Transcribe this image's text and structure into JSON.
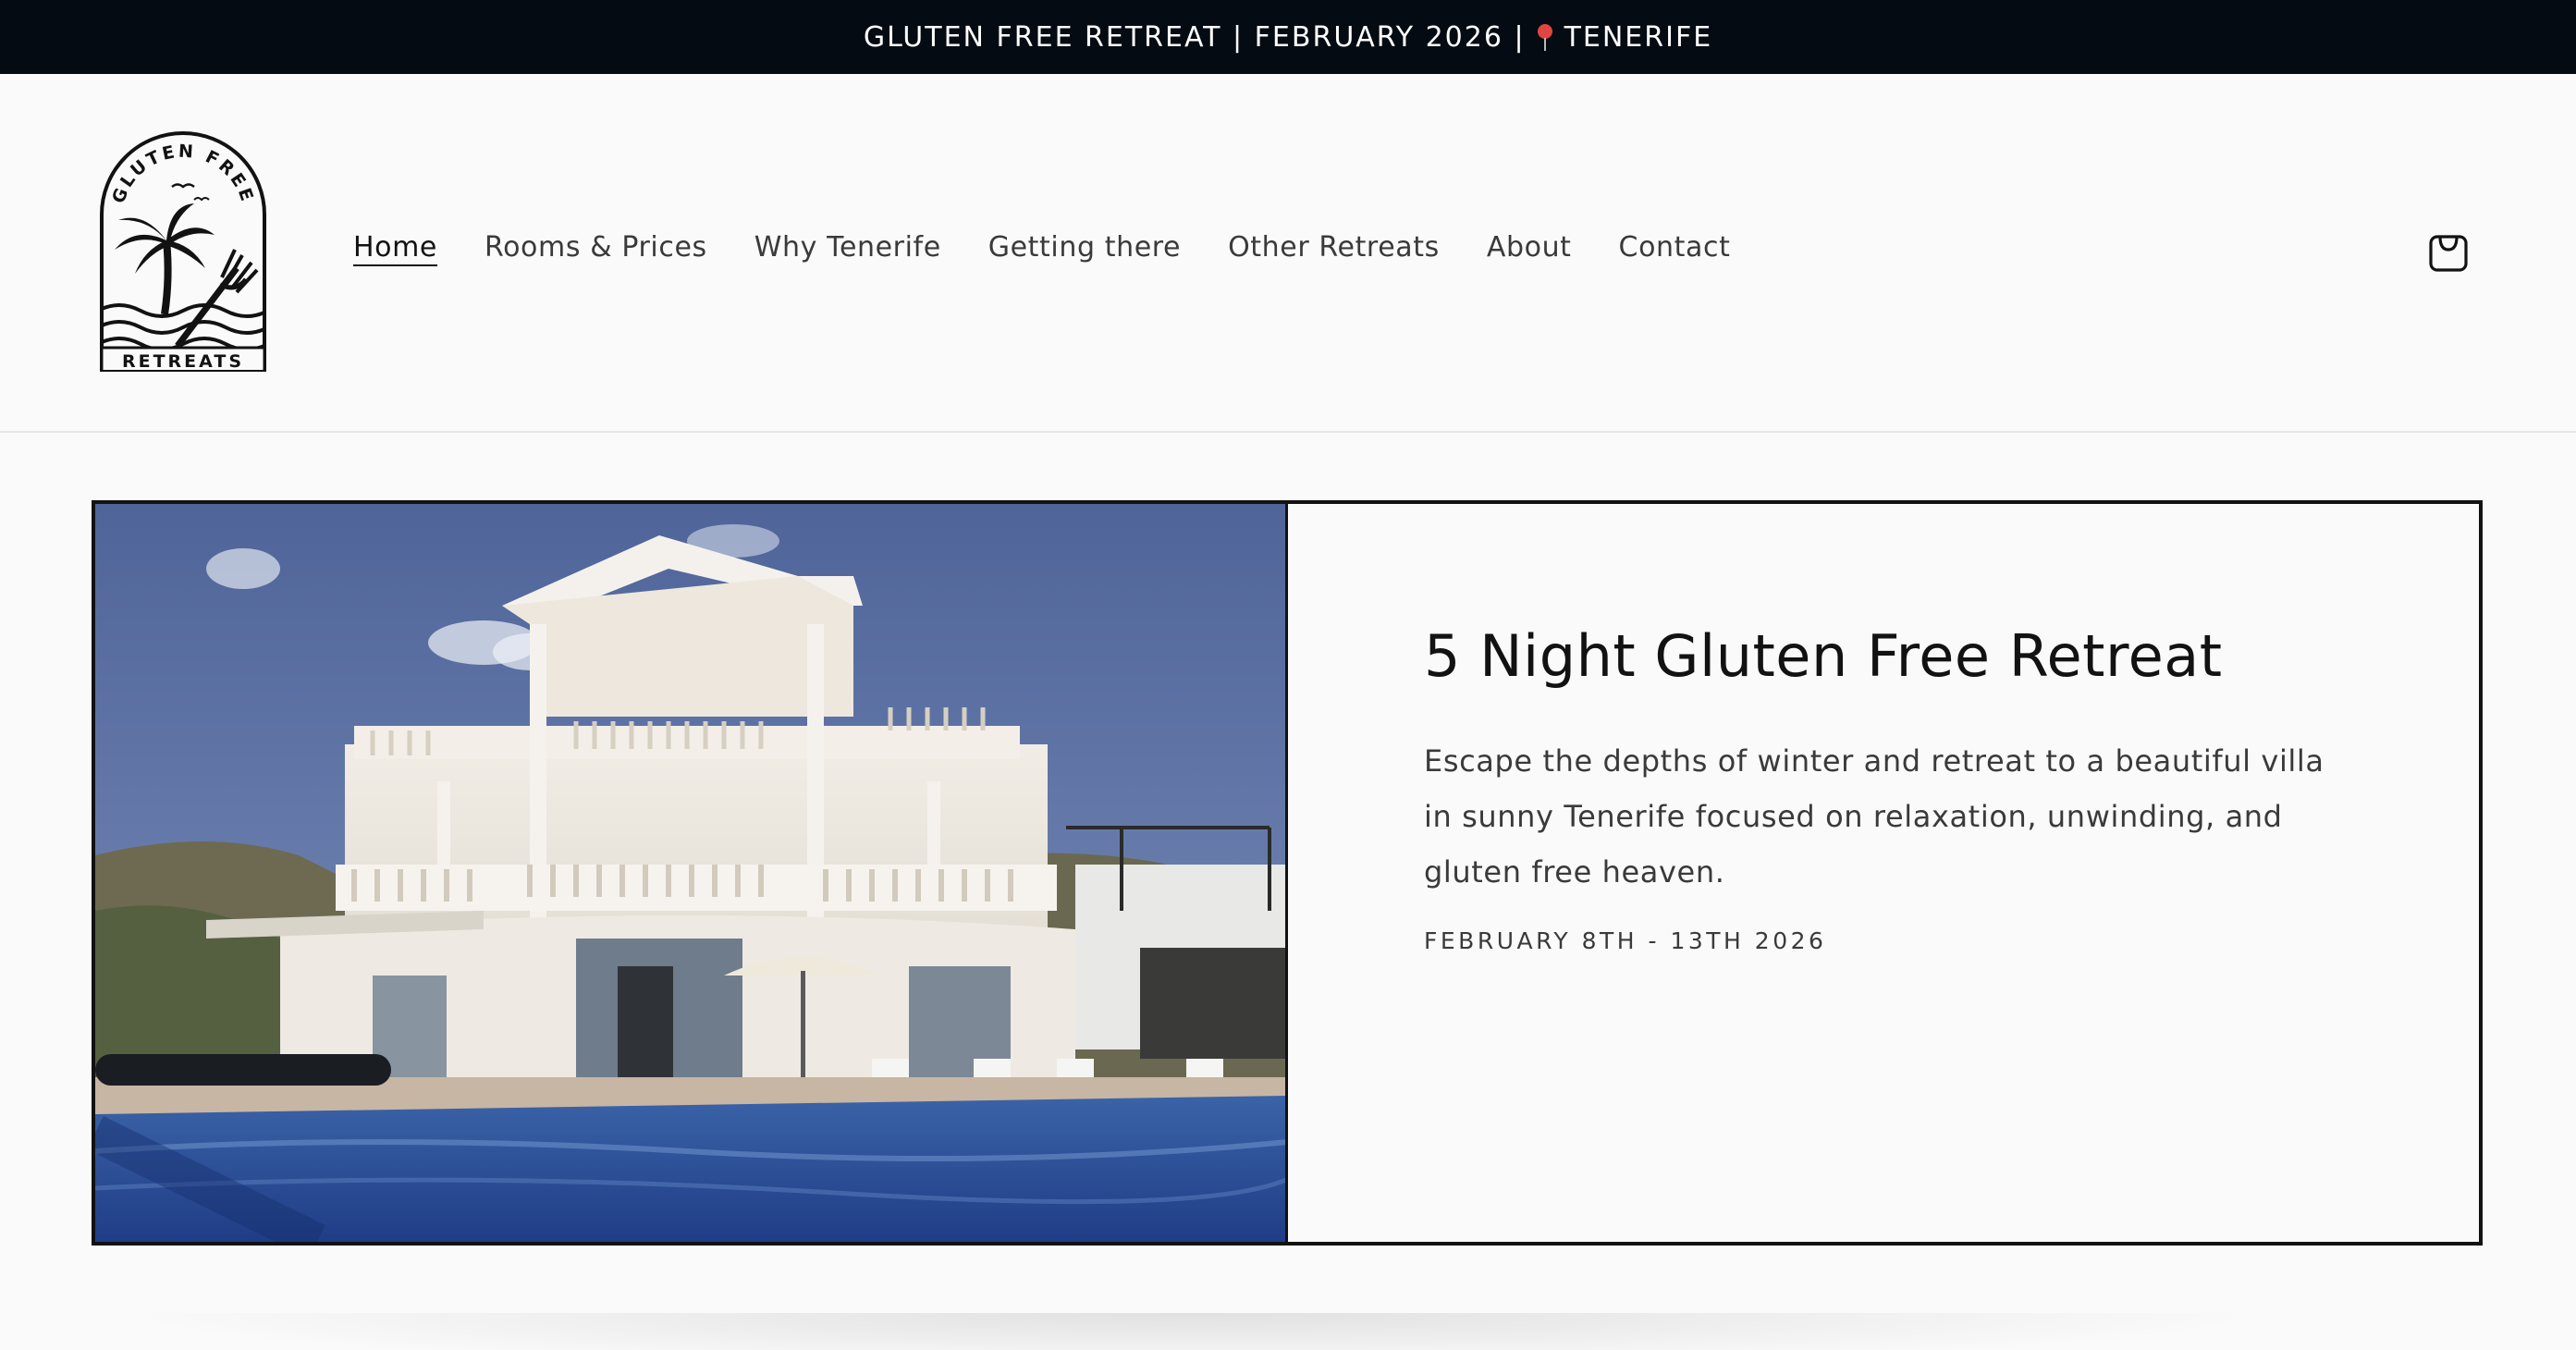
{
  "announcement": {
    "text_before": "GLUTEN FREE RETREAT | FEBRUARY 2026 |",
    "text_after": "TENERIFE"
  },
  "logo": {
    "arc_text": "GLUTEN FREE",
    "banner_text": "RETREATS"
  },
  "nav": {
    "items": [
      {
        "label": "Home",
        "active": true
      },
      {
        "label": "Rooms & Prices"
      },
      {
        "label": "Why Tenerife"
      },
      {
        "label": "Getting there"
      },
      {
        "label": "Other Retreats"
      },
      {
        "label": "About"
      },
      {
        "label": "Contact"
      }
    ]
  },
  "feature": {
    "title": "5 Night Gluten Free Retreat",
    "description": "Escape the depths of winter and retreat to a beautiful villa in sunny Tenerife focused on relaxation, unwinding, and gluten free heaven.",
    "dates": "FEBRUARY 8TH - 13TH 2026"
  },
  "icons": {
    "announcement": "map-pin-icon",
    "cart": "shopping-bag-icon"
  },
  "colors": {
    "announcement_bg": "#050b12",
    "page_bg": "#fafafa",
    "text": "#121212",
    "pin": "#e0463f"
  }
}
